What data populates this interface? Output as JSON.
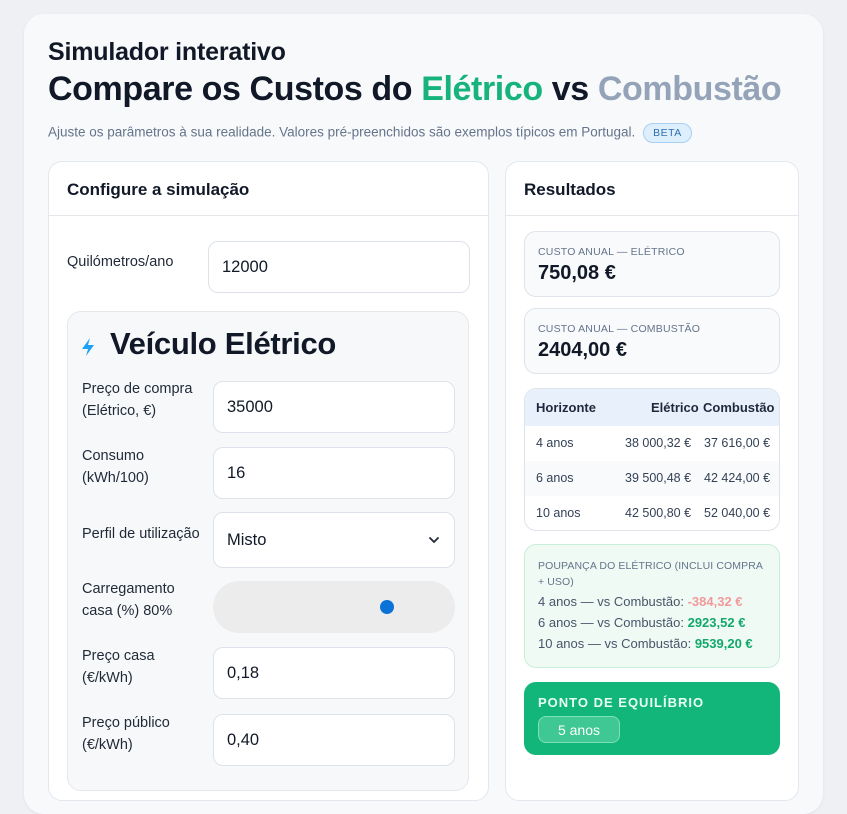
{
  "header": {
    "kicker": "Simulador interativo",
    "title_prefix": "Compare os Custos do",
    "title_ev": "Elétrico",
    "title_vs": "vs",
    "title_ice": "Combustão",
    "subtitle": "Ajuste os parâmetros à sua realidade. Valores pré-preenchidos são exemplos típicos em Portugal.",
    "badge": "BETA"
  },
  "config": {
    "title": "Configure a simulação",
    "km_label": "Quilómetros/ano",
    "km_value": "12000",
    "ev": {
      "title": "Veículo Elétrico",
      "price_label_1": "Preço de compra",
      "price_label_2": "(Elétrico, €)",
      "price_value": "35000",
      "consumption_label_1": "Consumo",
      "consumption_label_2": "(kWh/100)",
      "consumption_value": "16",
      "profile_label": "Perfil de utilização",
      "profile_value": "Misto",
      "home_charge_label_1": "Carregamento",
      "home_charge_label_2": "casa (%) 80%",
      "home_charge_percent": 80,
      "home_price_label_1": "Preço casa",
      "home_price_label_2": "(€/kWh)",
      "home_price_value": "0,18",
      "public_price_label_1": "Preço público",
      "public_price_label_2": "(€/kWh)",
      "public_price_value": "0,40"
    }
  },
  "results": {
    "title": "Resultados",
    "annual_ev_label": "CUSTO ANUAL — ELÉTRICO",
    "annual_ev_value": "750,08 €",
    "annual_ice_label": "CUSTO ANUAL — COMBUSTÃO",
    "annual_ice_value": "2404,00 €",
    "table": {
      "headers": [
        "Horizonte",
        "Elétrico",
        "Combustão"
      ],
      "rows": [
        [
          "4 anos",
          "38 000,32 €",
          "37 616,00 €"
        ],
        [
          "6 anos",
          "39 500,48 €",
          "42 424,00 €"
        ],
        [
          "10 anos",
          "42 500,80 €",
          "52 040,00 €"
        ]
      ]
    },
    "savings": {
      "heading": "POUPANÇA DO ELÉTRICO (INCLUI COMPRA + USO)",
      "lines": [
        {
          "label": "4 anos — vs Combustão:",
          "value": "-384,32 €"
        },
        {
          "label": "6 anos — vs Combustão:",
          "value": "2923,52 €"
        },
        {
          "label": "10 anos — vs Combustão:",
          "value": "9539,20 €"
        }
      ]
    },
    "breakeven_label": "PONTO DE EQUILÍBRIO",
    "breakeven_value": "5 anos"
  },
  "colors": {
    "accent_green": "#16b37c",
    "muted_gray": "#94a3b8",
    "negative": "#f19a9a",
    "positive": "#12a86c",
    "slider_thumb": "#0b72d8"
  },
  "icons": [
    "lightning-bolt-icon",
    "chevron-down-icon"
  ]
}
